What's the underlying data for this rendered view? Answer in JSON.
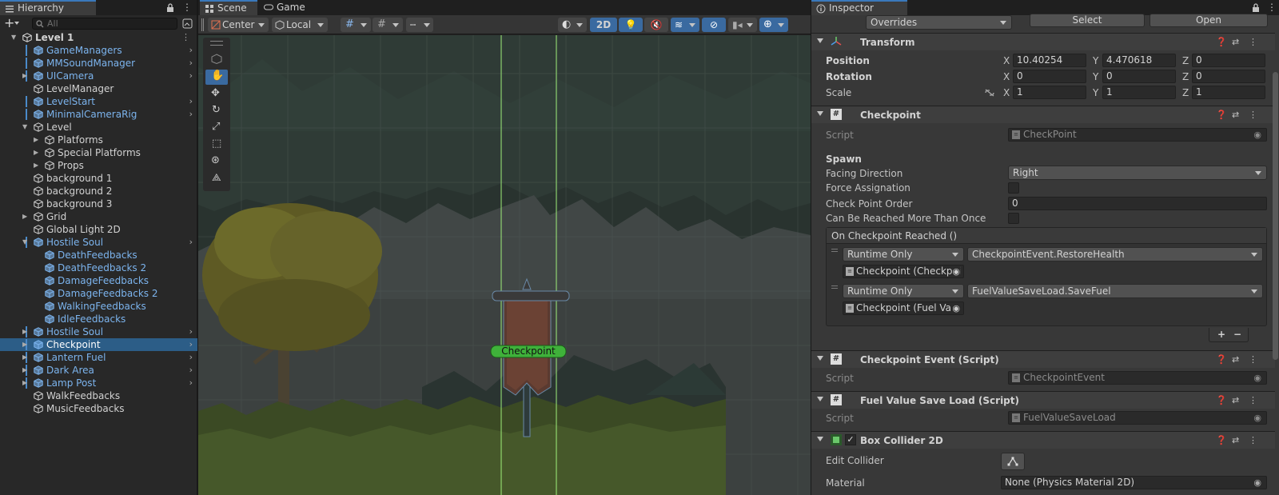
{
  "hierarchy": {
    "tab_label": "Hierarchy",
    "search_placeholder": "All",
    "items": [
      {
        "label": "Level 1",
        "depth": 0,
        "type": "scene",
        "fold": "open",
        "bold": true
      },
      {
        "label": "GameManagers",
        "depth": 1,
        "type": "prefab",
        "chevron": true,
        "bar": true
      },
      {
        "label": "MMSoundManager",
        "depth": 1,
        "type": "prefab",
        "chevron": true,
        "bar": true
      },
      {
        "label": "UICamera",
        "depth": 1,
        "type": "prefab",
        "fold": "closed",
        "chevron": true,
        "bar": true
      },
      {
        "label": "LevelManager",
        "depth": 1,
        "type": "object"
      },
      {
        "label": "LevelStart",
        "depth": 1,
        "type": "prefab",
        "chevron": true,
        "bar": true
      },
      {
        "label": "MinimalCameraRig",
        "depth": 1,
        "type": "prefab",
        "chevron": true,
        "bar": true
      },
      {
        "label": "Level",
        "depth": 1,
        "type": "object",
        "fold": "open"
      },
      {
        "label": "Platforms",
        "depth": 2,
        "type": "object",
        "fold": "closed"
      },
      {
        "label": "Special Platforms",
        "depth": 2,
        "type": "object",
        "fold": "closed"
      },
      {
        "label": "Props",
        "depth": 2,
        "type": "object",
        "fold": "closed"
      },
      {
        "label": "background 1",
        "depth": 1,
        "type": "object"
      },
      {
        "label": "background 2",
        "depth": 1,
        "type": "object"
      },
      {
        "label": "background 3",
        "depth": 1,
        "type": "object"
      },
      {
        "label": "Grid",
        "depth": 1,
        "type": "object",
        "fold": "closed"
      },
      {
        "label": "Global Light 2D",
        "depth": 1,
        "type": "object"
      },
      {
        "label": "Hostile Soul",
        "depth": 1,
        "type": "prefab",
        "fold": "open",
        "chevron": true,
        "bar": true
      },
      {
        "label": "DeathFeedbacks",
        "depth": 2,
        "type": "prefab"
      },
      {
        "label": "DeathFeedbacks 2",
        "depth": 2,
        "type": "prefab"
      },
      {
        "label": "DamageFeedbacks",
        "depth": 2,
        "type": "prefab"
      },
      {
        "label": "DamageFeedbacks 2",
        "depth": 2,
        "type": "prefab"
      },
      {
        "label": "WalkingFeedbacks",
        "depth": 2,
        "type": "prefab"
      },
      {
        "label": "IdleFeedbacks",
        "depth": 2,
        "type": "prefab"
      },
      {
        "label": "Hostile Soul",
        "depth": 1,
        "type": "prefab",
        "fold": "closed",
        "chevron": true,
        "bar": true
      },
      {
        "label": "Checkpoint",
        "depth": 1,
        "type": "prefab",
        "fold": "closed",
        "chevron": true,
        "bar": true,
        "selected": true
      },
      {
        "label": "Lantern Fuel",
        "depth": 1,
        "type": "prefab",
        "fold": "closed",
        "chevron": true,
        "bar": true
      },
      {
        "label": "Dark Area",
        "depth": 1,
        "type": "prefab",
        "fold": "closed",
        "chevron": true,
        "bar": true
      },
      {
        "label": "Lamp Post",
        "depth": 1,
        "type": "prefab",
        "fold": "closed",
        "chevron": true,
        "bar": true
      },
      {
        "label": "WalkFeedbacks",
        "depth": 1,
        "type": "object"
      },
      {
        "label": "MusicFeedbacks",
        "depth": 1,
        "type": "object"
      }
    ]
  },
  "scene": {
    "tab_scene": "Scene",
    "tab_game": "Game",
    "pivot_mode": "Center",
    "pivot_rotation": "Local",
    "mode_2d": "2D",
    "checkpoint_label": "Checkpoint"
  },
  "inspector": {
    "tab_label": "Inspector",
    "overrides": "Overrides",
    "select_button": "Select",
    "open_button": "Open",
    "transform": {
      "title": "Transform",
      "position_label": "Position",
      "rotation_label": "Rotation",
      "scale_label": "Scale",
      "position": {
        "x": "10.40254",
        "y": "4.470618",
        "z": "0"
      },
      "rotation": {
        "x": "0",
        "y": "0",
        "z": "0"
      },
      "scale": {
        "x": "1",
        "y": "1",
        "z": "1"
      },
      "axis_x": "X",
      "axis_y": "Y",
      "axis_z": "Z"
    },
    "checkpoint": {
      "title": "Checkpoint",
      "script_label": "Script",
      "script_value": "CheckPoint",
      "spawn_header": "Spawn",
      "facing_label": "Facing Direction",
      "facing_value": "Right",
      "force_label": "Force Assignation",
      "order_label": "Check Point Order",
      "order_value": "0",
      "reached_label": "Can Be Reached More Than Once",
      "event_header": "On Checkpoint Reached ()",
      "events": [
        {
          "mode": "Runtime Only",
          "function": "CheckpointEvent.RestoreHealth",
          "target": "Checkpoint (Checkpoi"
        },
        {
          "mode": "Runtime Only",
          "function": "FuelValueSaveLoad.SaveFuel",
          "target": "Checkpoint (Fuel Valu"
        }
      ],
      "add_button": "+",
      "remove_button": "−"
    },
    "checkpoint_event": {
      "title": "Checkpoint Event (Script)",
      "script_label": "Script",
      "script_value": "CheckpointEvent"
    },
    "fuel_save": {
      "title": "Fuel Value Save Load (Script)",
      "script_label": "Script",
      "script_value": "FuelValueSaveLoad"
    },
    "box_collider": {
      "title": "Box Collider 2D",
      "edit_label": "Edit Collider",
      "material_label": "Material",
      "material_value": "None (Physics Material 2D)"
    }
  }
}
